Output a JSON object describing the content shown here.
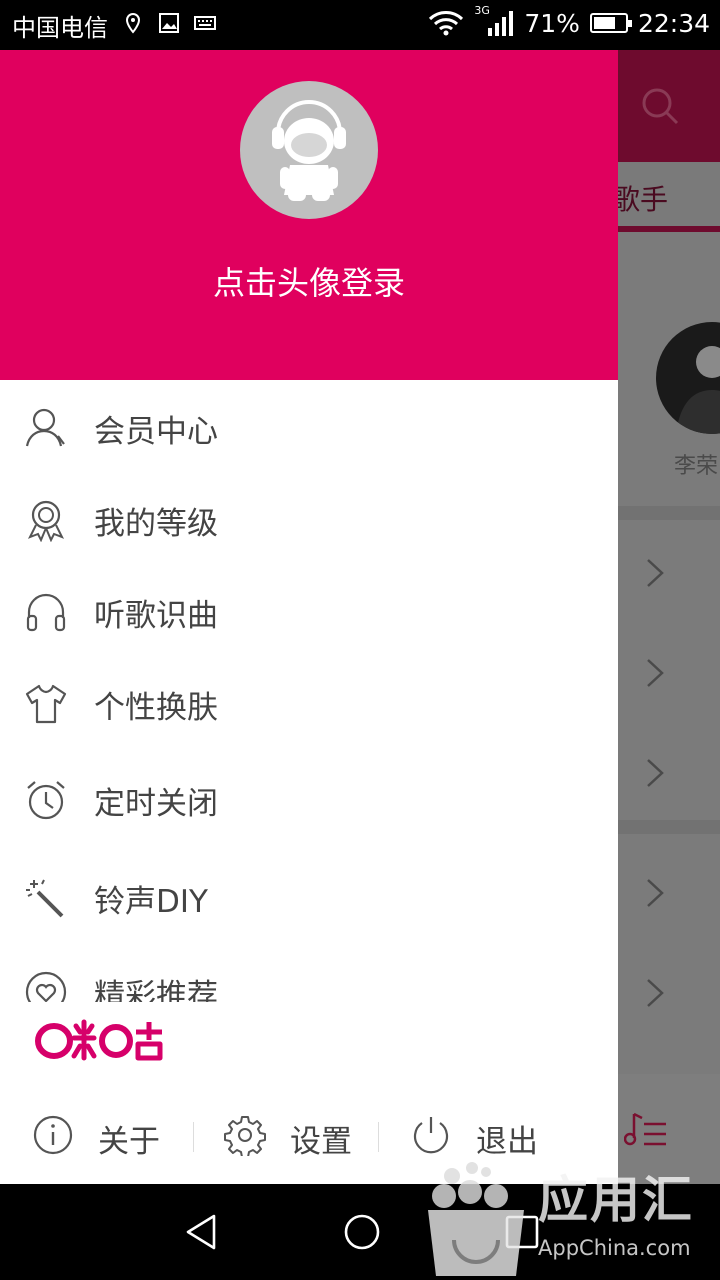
{
  "status_bar": {
    "carrier": "中国电信",
    "network": "3G",
    "battery": "71%",
    "battery_level": 0.71,
    "time": "22:34"
  },
  "drawer": {
    "login_prompt": "点击头像登录",
    "header_color": "#e0005e",
    "menu": [
      {
        "label": "会员中心",
        "icon": "user-icon"
      },
      {
        "label": "我的等级",
        "icon": "medal-icon"
      },
      {
        "label": "听歌识曲",
        "icon": "headphones-icon"
      },
      {
        "label": "个性换肤",
        "icon": "tshirt-icon"
      },
      {
        "label": "定时关闭",
        "icon": "alarm-clock-icon"
      },
      {
        "label": "铃声DIY",
        "icon": "magic-wand-icon"
      },
      {
        "label": "精彩推荐",
        "icon": "heart-icon"
      }
    ],
    "brand": "咪咕",
    "bottom": {
      "about": "关于",
      "settings": "设置",
      "logout": "退出"
    }
  },
  "background_app": {
    "tab_partial": "歌手",
    "artist_partial": "李荣"
  },
  "watermark": {
    "title": "应用汇",
    "subtitle": "AppChina.com"
  }
}
